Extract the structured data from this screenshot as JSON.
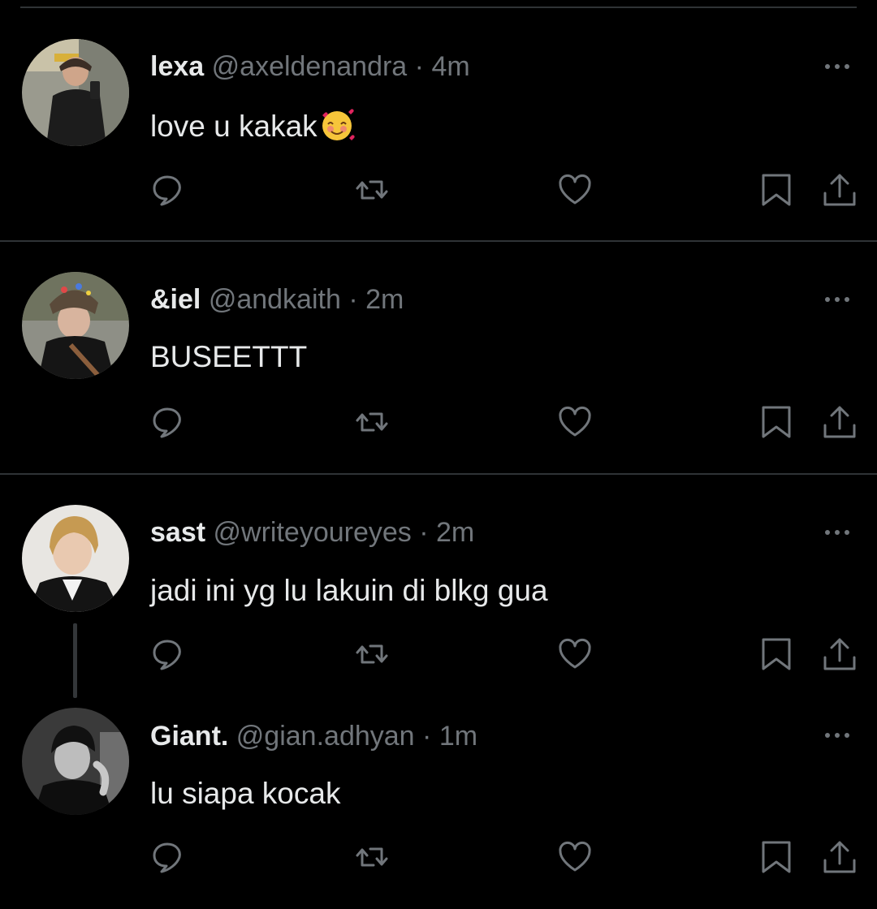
{
  "tweets": [
    {
      "name": "lexa",
      "handle": "@axeldenandra",
      "separator": "·",
      "time": "4m",
      "text": "love u kakak",
      "emoji": "smiling-face-with-hearts"
    },
    {
      "name": "&iel",
      "handle": "@andkaith",
      "separator": "·",
      "time": "2m",
      "text": "BUSEETTT"
    },
    {
      "name": "sast",
      "handle": "@writeyoureyes",
      "separator": "·",
      "time": "2m",
      "text": "jadi ini yg lu lakuin di blkg gua"
    },
    {
      "name": "Giant.",
      "handle": "@gian.adhyan",
      "separator": "·",
      "time": "1m",
      "text": "lu siapa kocak"
    }
  ],
  "icons": {
    "reply": "reply-icon",
    "retweet": "retweet-icon",
    "like": "heart-icon",
    "bookmark": "bookmark-icon",
    "share": "share-icon",
    "more": "more-icon"
  },
  "colors": {
    "background": "#000000",
    "text": "#e7e9ea",
    "secondary": "#71767b",
    "divider": "#2f3336"
  }
}
